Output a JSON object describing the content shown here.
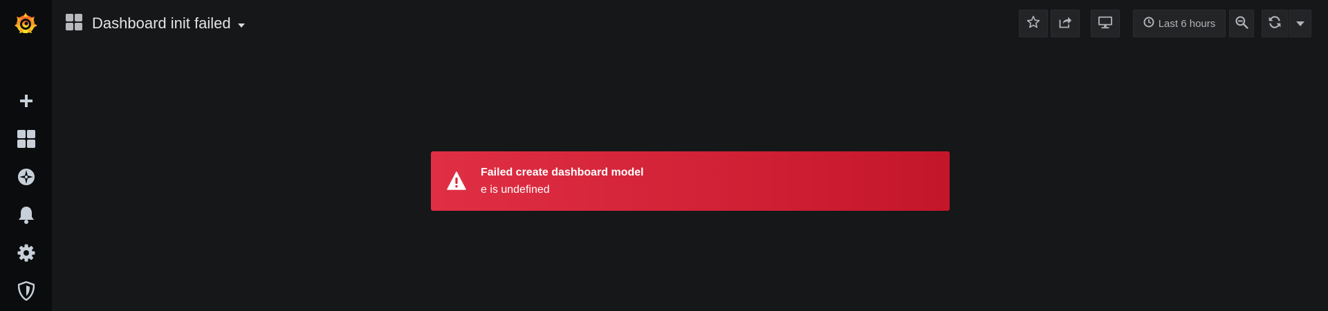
{
  "sidebar": {
    "logo": "grafana-logo",
    "items": [
      {
        "icon": "plus-icon"
      },
      {
        "icon": "dashboards-icon"
      },
      {
        "icon": "explore-icon"
      },
      {
        "icon": "bell-icon"
      },
      {
        "icon": "gear-icon"
      },
      {
        "icon": "shield-icon"
      }
    ]
  },
  "navbar": {
    "title": "Dashboard init failed",
    "title_icon": "dashboard-grid-icon",
    "buttons": {
      "star": "star-icon",
      "share": "share-icon",
      "tv": "monitor-icon",
      "time_range": "Last 6 hours",
      "zoom_out": "zoom-out-icon",
      "refresh": "refresh-icon",
      "refresh_dropdown": "caret-down-icon"
    }
  },
  "alert": {
    "title": "Failed create dashboard model",
    "text": "e is undefined",
    "icon": "warning-icon",
    "color_start": "#e02f44",
    "color_end": "#c4162a"
  }
}
